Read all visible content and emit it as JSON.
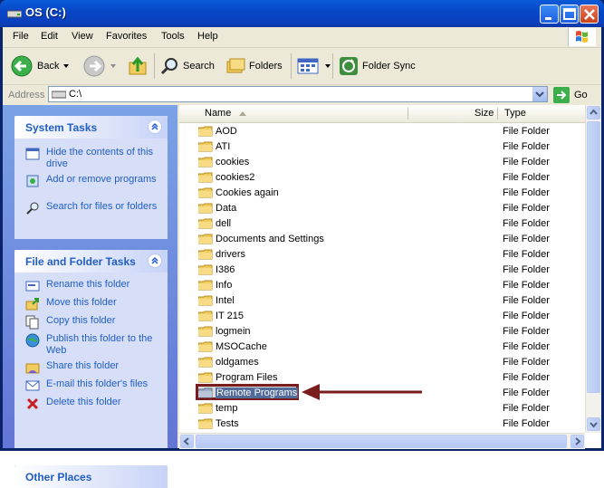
{
  "window": {
    "title": "OS (C:)"
  },
  "menu": [
    "File",
    "Edit",
    "View",
    "Favorites",
    "Tools",
    "Help"
  ],
  "toolbar": {
    "back": "Back",
    "search": "Search",
    "folders": "Folders",
    "folder_sync": "Folder Sync"
  },
  "address": {
    "label": "Address",
    "value": "C:\\",
    "go": "Go"
  },
  "system_tasks": {
    "title": "System Tasks",
    "items": [
      "Hide the contents of this drive",
      "Add or remove programs",
      "Search for files or folders"
    ]
  },
  "file_tasks": {
    "title": "File and Folder Tasks",
    "items": [
      "Rename this folder",
      "Move this folder",
      "Copy this folder",
      "Publish this folder to the Web",
      "Share this folder",
      "E-mail this folder's files",
      "Delete this folder"
    ]
  },
  "other_places": {
    "title": "Other Places"
  },
  "columns": {
    "name": "Name",
    "size": "Size",
    "type": "Type"
  },
  "files": [
    {
      "name": "AOD",
      "type": "File Folder"
    },
    {
      "name": "ATI",
      "type": "File Folder"
    },
    {
      "name": "cookies",
      "type": "File Folder"
    },
    {
      "name": "cookies2",
      "type": "File Folder"
    },
    {
      "name": "Cookies again",
      "type": "File Folder"
    },
    {
      "name": "Data",
      "type": "File Folder"
    },
    {
      "name": "dell",
      "type": "File Folder"
    },
    {
      "name": "Documents and Settings",
      "type": "File Folder"
    },
    {
      "name": "drivers",
      "type": "File Folder"
    },
    {
      "name": "I386",
      "type": "File Folder"
    },
    {
      "name": "Info",
      "type": "File Folder"
    },
    {
      "name": "Intel",
      "type": "File Folder"
    },
    {
      "name": "IT 215",
      "type": "File Folder"
    },
    {
      "name": "logmein",
      "type": "File Folder"
    },
    {
      "name": "MSOCache",
      "type": "File Folder"
    },
    {
      "name": "oldgames",
      "type": "File Folder"
    },
    {
      "name": "Program Files",
      "type": "File Folder"
    },
    {
      "name": "Remote Programs",
      "type": "File Folder"
    },
    {
      "name": "temp",
      "type": "File Folder"
    },
    {
      "name": "Tests",
      "type": "File Folder"
    }
  ],
  "colors": {
    "title_blue": "#0a5bd8",
    "task_link": "#215dc6",
    "annotation": "#7a1d1d"
  }
}
